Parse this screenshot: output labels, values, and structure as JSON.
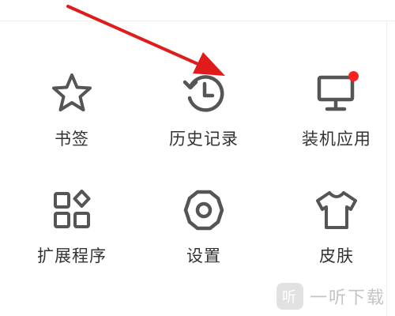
{
  "menu": {
    "items": [
      {
        "label": "书签",
        "icon": "star-icon"
      },
      {
        "label": "历史记录",
        "icon": "history-icon"
      },
      {
        "label": "装机应用",
        "icon": "monitor-icon",
        "badge": true
      },
      {
        "label": "扩展程序",
        "icon": "extensions-icon"
      },
      {
        "label": "设置",
        "icon": "gear-icon"
      },
      {
        "label": "皮肤",
        "icon": "shirt-icon"
      }
    ]
  },
  "watermark": {
    "logo_glyph": "听",
    "text": "一听下载"
  },
  "colors": {
    "icon": "#555555",
    "text": "#333333",
    "badge": "#ff1e1e",
    "arrow": "#e01b1b"
  }
}
